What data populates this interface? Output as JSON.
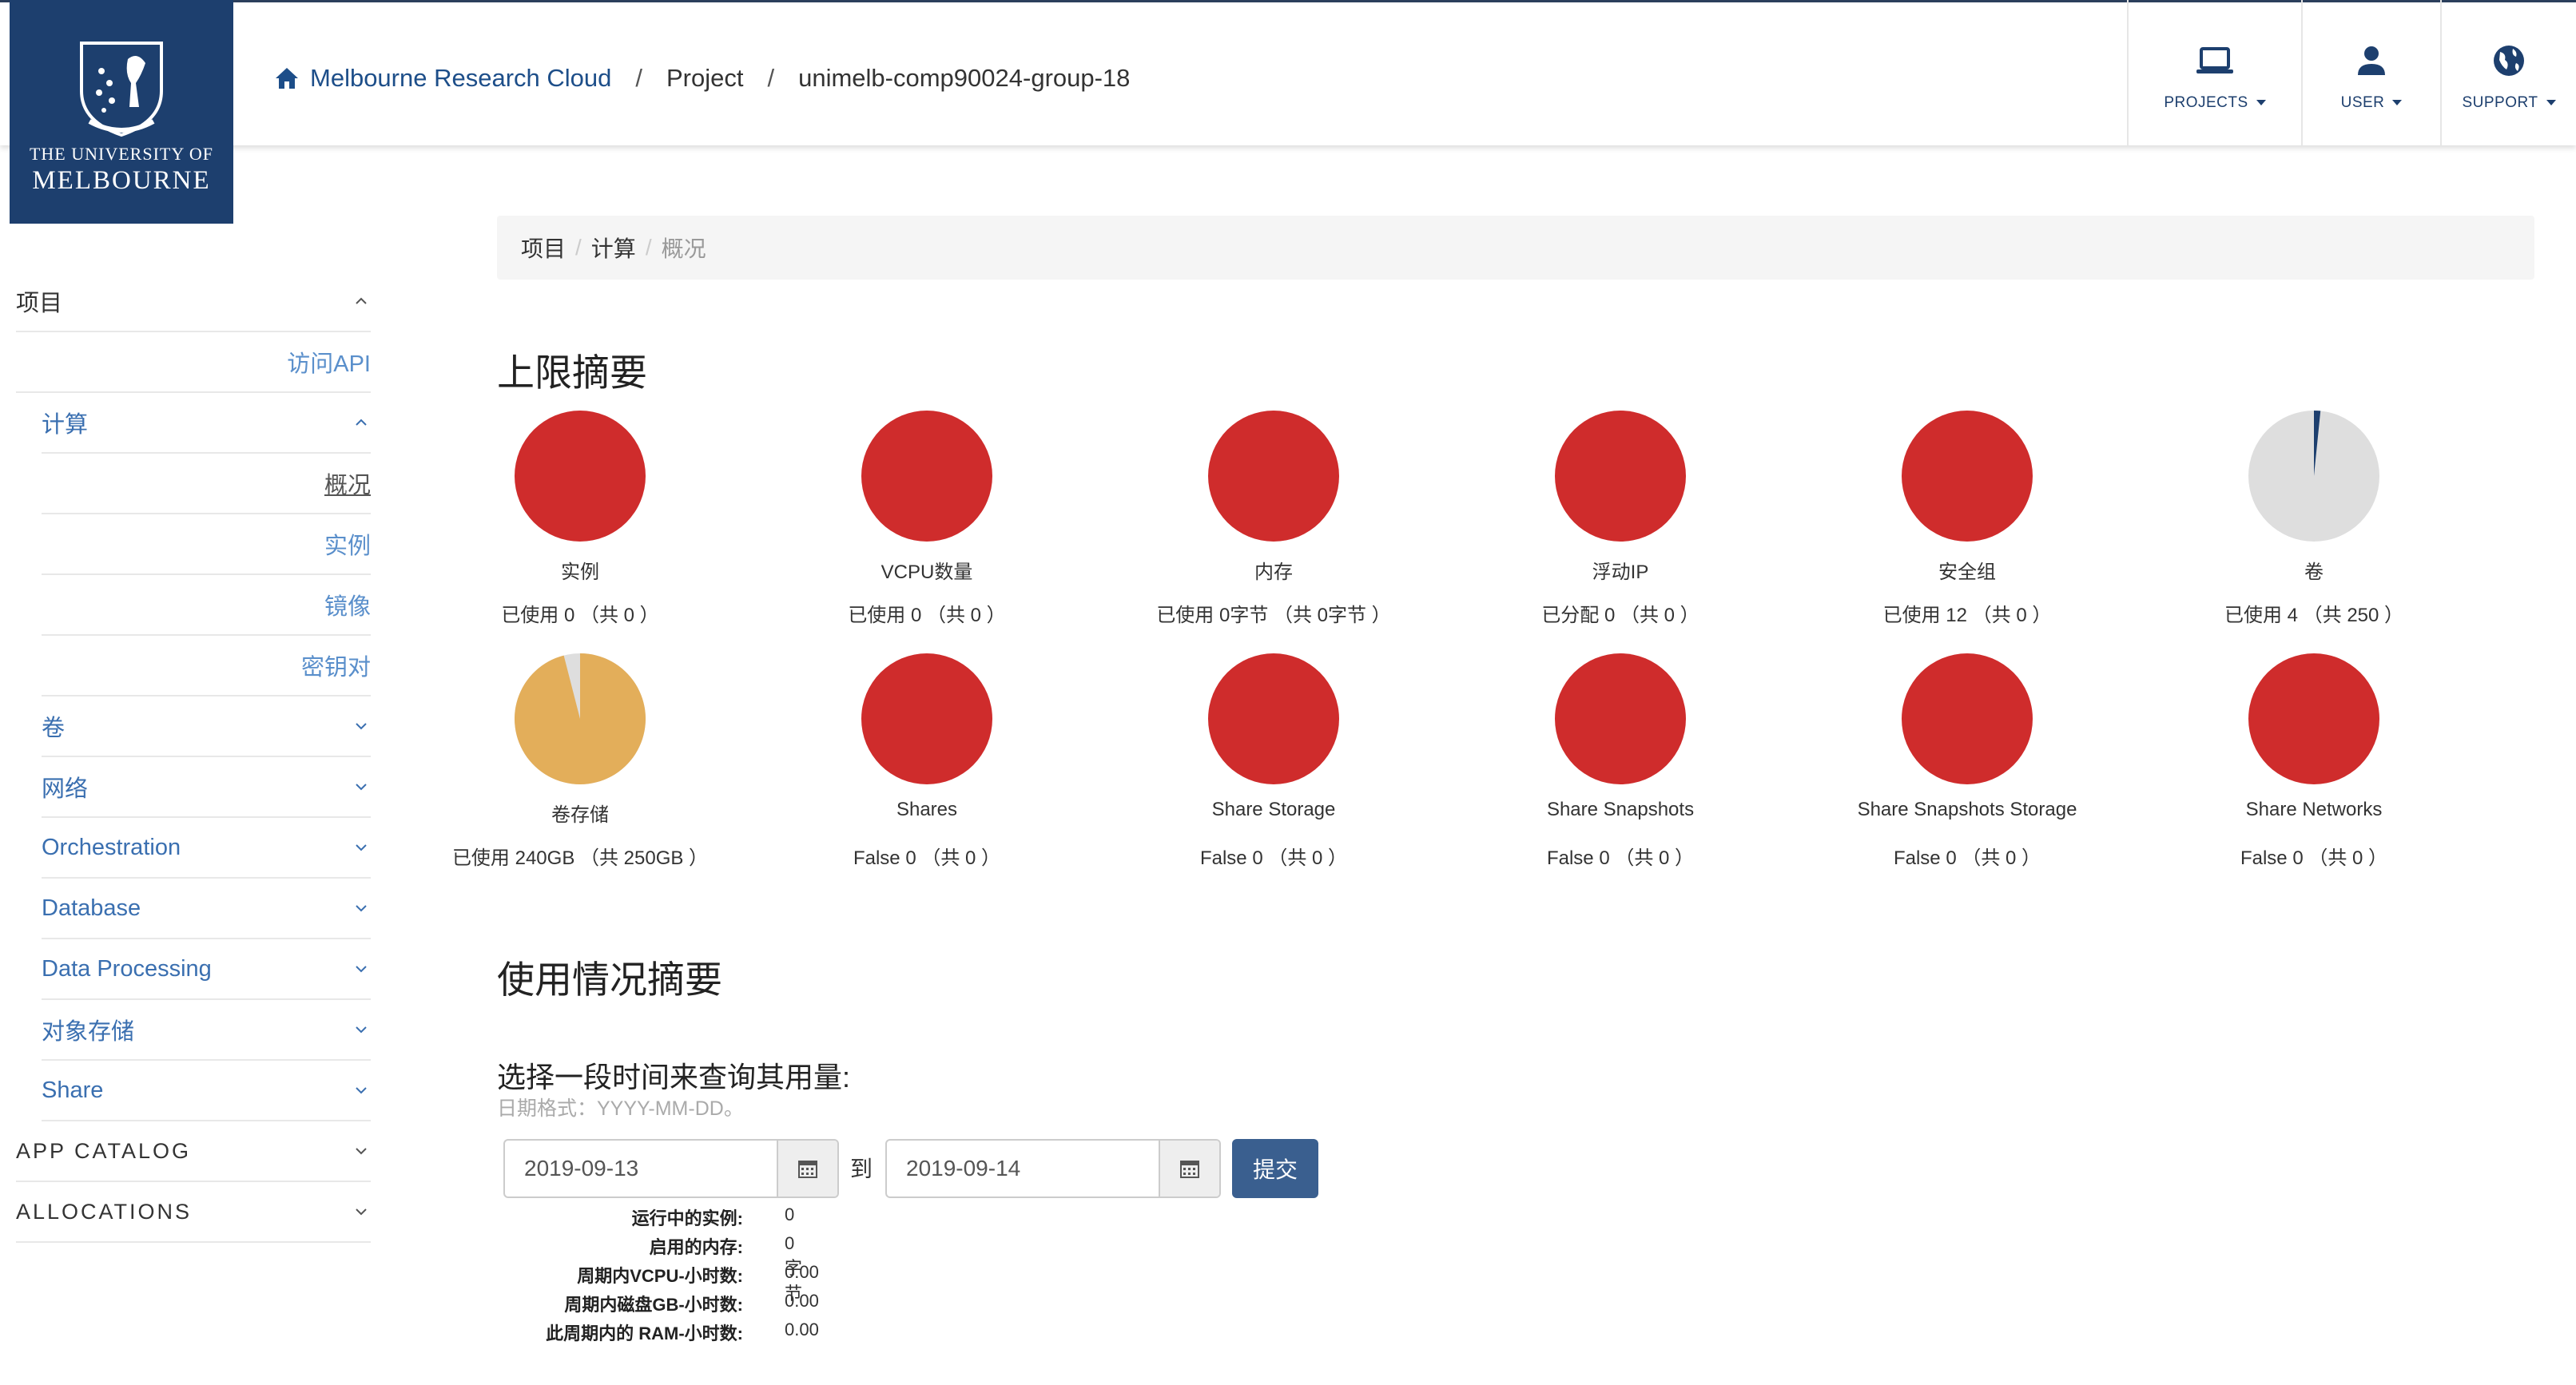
{
  "logo": {
    "line1": "THE UNIVERSITY OF",
    "line2": "MELBOURNE"
  },
  "breadcrumb_top": {
    "home": "Melbourne Research Cloud",
    "items": [
      "Project",
      "unimelb-comp90024-group-18"
    ]
  },
  "header_nav": [
    {
      "label": "PROJECTS",
      "icon": "laptop-icon"
    },
    {
      "label": "USER",
      "icon": "user-icon"
    },
    {
      "label": "SUPPORT",
      "icon": "globe-icon"
    }
  ],
  "sidebar": {
    "project": "项目",
    "api_access": "访问API",
    "compute": "计算",
    "overview": "概况",
    "instances": "实例",
    "images": "镜像",
    "keypairs": "密钥对",
    "volumes": "卷",
    "network": "网络",
    "orchestration": "Orchestration",
    "database": "Database",
    "data_processing": "Data Processing",
    "object_store": "对象存储",
    "share": "Share",
    "app_catalog": "APP CATALOG",
    "allocations": "ALLOCATIONS"
  },
  "page_breadcrumb": {
    "l1": "项目",
    "l2": "计算",
    "current": "概况"
  },
  "limits": {
    "heading": "上限摘要",
    "colors": {
      "full": "#cf2c2c",
      "used": "#1d3f6e",
      "free": "#dedede",
      "warn": "#e3ae5a",
      "warn_free": "#dedede"
    },
    "charts": [
      {
        "title": "实例",
        "subtitle": "已使用 0 （共 0 ）",
        "used": 0,
        "total": 0
      },
      {
        "title": "VCPU数量",
        "subtitle": "已使用 0 （共 0 ）",
        "used": 0,
        "total": 0
      },
      {
        "title": "内存",
        "subtitle": "已使用 0字节 （共 0字节 ）",
        "used": 0,
        "total": 0
      },
      {
        "title": "浮动IP",
        "subtitle": "已分配 0 （共 0 ）",
        "used": 0,
        "total": 0
      },
      {
        "title": "安全组",
        "subtitle": "已使用 12 （共 0 ）",
        "used": 12,
        "total": 0
      },
      {
        "title": "卷",
        "subtitle": "已使用 4 （共 250 ）",
        "used": 4,
        "total": 250
      },
      {
        "title": "卷存储",
        "subtitle": "已使用 240GB （共 250GB ）",
        "used": 240,
        "total": 250
      },
      {
        "title": "Shares",
        "subtitle": "False 0 （共 0 ）",
        "used": 0,
        "total": 0
      },
      {
        "title": "Share Storage",
        "subtitle": "False 0 （共 0 ）",
        "used": 0,
        "total": 0
      },
      {
        "title": "Share Snapshots",
        "subtitle": "False 0 （共 0 ）",
        "used": 0,
        "total": 0
      },
      {
        "title": "Share Snapshots Storage",
        "subtitle": "False 0 （共 0 ）",
        "used": 0,
        "total": 0
      },
      {
        "title": "Share Networks",
        "subtitle": "False 0 （共 0 ）",
        "used": 0,
        "total": 0
      }
    ]
  },
  "usage": {
    "heading": "使用情况摘要",
    "query_title": "选择一段时间来查询其用量:",
    "hint": "日期格式：YYYY-MM-DD。",
    "start": "2019-09-13",
    "to": "到",
    "end": "2019-09-14",
    "submit": "提交",
    "stats": [
      {
        "k": "运行中的实例:",
        "v": "0"
      },
      {
        "k": "启用的内存:",
        "v": "0字节"
      },
      {
        "k": "周期内VCPU-小时数:",
        "v": "0.00"
      },
      {
        "k": "周期内磁盘GB-小时数:",
        "v": "0.00"
      },
      {
        "k": "此周期内的 RAM-小时数:",
        "v": "0.00"
      }
    ]
  }
}
